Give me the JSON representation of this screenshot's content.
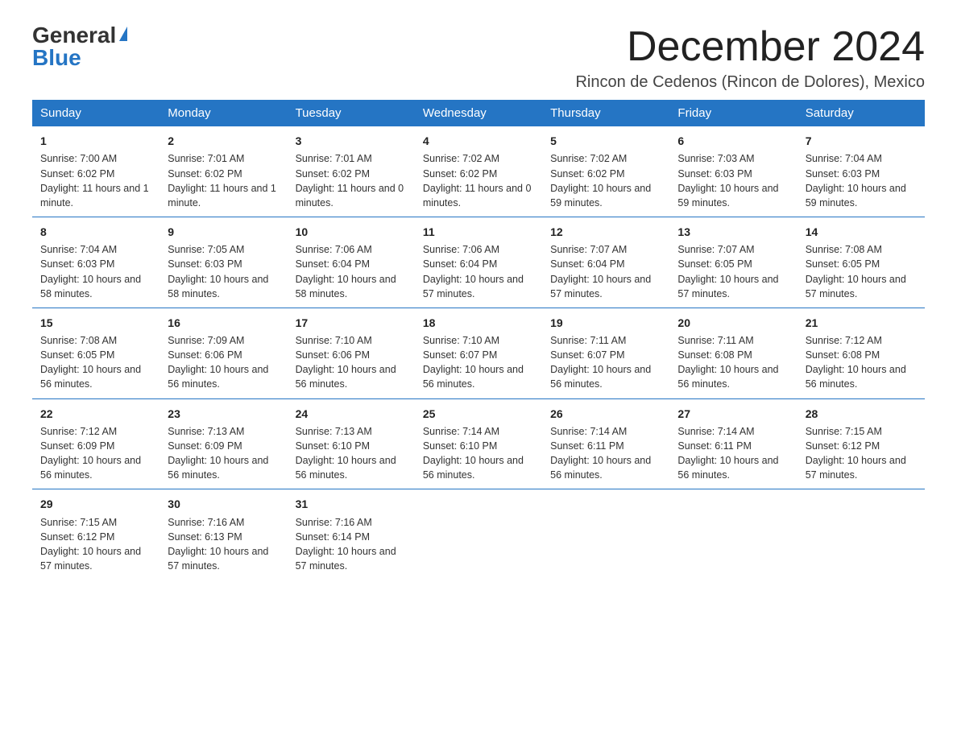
{
  "header": {
    "logo_general": "General",
    "logo_blue": "Blue",
    "month_title": "December 2024",
    "subtitle": "Rincon de Cedenos (Rincon de Dolores), Mexico"
  },
  "days_of_week": [
    "Sunday",
    "Monday",
    "Tuesday",
    "Wednesday",
    "Thursday",
    "Friday",
    "Saturday"
  ],
  "weeks": [
    [
      {
        "day": "1",
        "sunrise": "7:00 AM",
        "sunset": "6:02 PM",
        "daylight": "11 hours and 1 minute."
      },
      {
        "day": "2",
        "sunrise": "7:01 AM",
        "sunset": "6:02 PM",
        "daylight": "11 hours and 1 minute."
      },
      {
        "day": "3",
        "sunrise": "7:01 AM",
        "sunset": "6:02 PM",
        "daylight": "11 hours and 0 minutes."
      },
      {
        "day": "4",
        "sunrise": "7:02 AM",
        "sunset": "6:02 PM",
        "daylight": "11 hours and 0 minutes."
      },
      {
        "day": "5",
        "sunrise": "7:02 AM",
        "sunset": "6:02 PM",
        "daylight": "10 hours and 59 minutes."
      },
      {
        "day": "6",
        "sunrise": "7:03 AM",
        "sunset": "6:03 PM",
        "daylight": "10 hours and 59 minutes."
      },
      {
        "day": "7",
        "sunrise": "7:04 AM",
        "sunset": "6:03 PM",
        "daylight": "10 hours and 59 minutes."
      }
    ],
    [
      {
        "day": "8",
        "sunrise": "7:04 AM",
        "sunset": "6:03 PM",
        "daylight": "10 hours and 58 minutes."
      },
      {
        "day": "9",
        "sunrise": "7:05 AM",
        "sunset": "6:03 PM",
        "daylight": "10 hours and 58 minutes."
      },
      {
        "day": "10",
        "sunrise": "7:06 AM",
        "sunset": "6:04 PM",
        "daylight": "10 hours and 58 minutes."
      },
      {
        "day": "11",
        "sunrise": "7:06 AM",
        "sunset": "6:04 PM",
        "daylight": "10 hours and 57 minutes."
      },
      {
        "day": "12",
        "sunrise": "7:07 AM",
        "sunset": "6:04 PM",
        "daylight": "10 hours and 57 minutes."
      },
      {
        "day": "13",
        "sunrise": "7:07 AM",
        "sunset": "6:05 PM",
        "daylight": "10 hours and 57 minutes."
      },
      {
        "day": "14",
        "sunrise": "7:08 AM",
        "sunset": "6:05 PM",
        "daylight": "10 hours and 57 minutes."
      }
    ],
    [
      {
        "day": "15",
        "sunrise": "7:08 AM",
        "sunset": "6:05 PM",
        "daylight": "10 hours and 56 minutes."
      },
      {
        "day": "16",
        "sunrise": "7:09 AM",
        "sunset": "6:06 PM",
        "daylight": "10 hours and 56 minutes."
      },
      {
        "day": "17",
        "sunrise": "7:10 AM",
        "sunset": "6:06 PM",
        "daylight": "10 hours and 56 minutes."
      },
      {
        "day": "18",
        "sunrise": "7:10 AM",
        "sunset": "6:07 PM",
        "daylight": "10 hours and 56 minutes."
      },
      {
        "day": "19",
        "sunrise": "7:11 AM",
        "sunset": "6:07 PM",
        "daylight": "10 hours and 56 minutes."
      },
      {
        "day": "20",
        "sunrise": "7:11 AM",
        "sunset": "6:08 PM",
        "daylight": "10 hours and 56 minutes."
      },
      {
        "day": "21",
        "sunrise": "7:12 AM",
        "sunset": "6:08 PM",
        "daylight": "10 hours and 56 minutes."
      }
    ],
    [
      {
        "day": "22",
        "sunrise": "7:12 AM",
        "sunset": "6:09 PM",
        "daylight": "10 hours and 56 minutes."
      },
      {
        "day": "23",
        "sunrise": "7:13 AM",
        "sunset": "6:09 PM",
        "daylight": "10 hours and 56 minutes."
      },
      {
        "day": "24",
        "sunrise": "7:13 AM",
        "sunset": "6:10 PM",
        "daylight": "10 hours and 56 minutes."
      },
      {
        "day": "25",
        "sunrise": "7:14 AM",
        "sunset": "6:10 PM",
        "daylight": "10 hours and 56 minutes."
      },
      {
        "day": "26",
        "sunrise": "7:14 AM",
        "sunset": "6:11 PM",
        "daylight": "10 hours and 56 minutes."
      },
      {
        "day": "27",
        "sunrise": "7:14 AM",
        "sunset": "6:11 PM",
        "daylight": "10 hours and 56 minutes."
      },
      {
        "day": "28",
        "sunrise": "7:15 AM",
        "sunset": "6:12 PM",
        "daylight": "10 hours and 57 minutes."
      }
    ],
    [
      {
        "day": "29",
        "sunrise": "7:15 AM",
        "sunset": "6:12 PM",
        "daylight": "10 hours and 57 minutes."
      },
      {
        "day": "30",
        "sunrise": "7:16 AM",
        "sunset": "6:13 PM",
        "daylight": "10 hours and 57 minutes."
      },
      {
        "day": "31",
        "sunrise": "7:16 AM",
        "sunset": "6:14 PM",
        "daylight": "10 hours and 57 minutes."
      },
      null,
      null,
      null,
      null
    ]
  ],
  "labels": {
    "sunrise": "Sunrise:",
    "sunset": "Sunset:",
    "daylight": "Daylight:"
  }
}
